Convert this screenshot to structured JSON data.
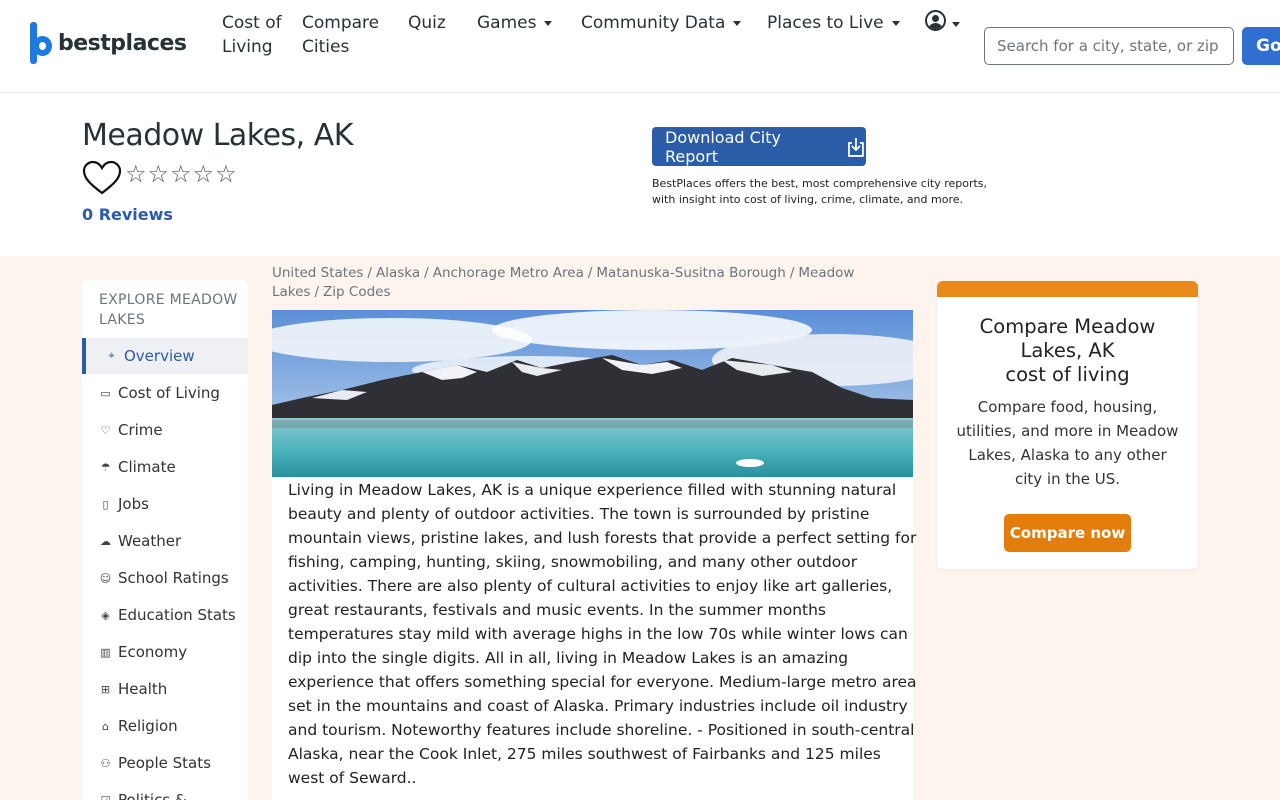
{
  "header": {
    "logo_text": "bestplaces",
    "nav": [
      {
        "label": "Cost of Living"
      },
      {
        "label": "Compare Cities"
      },
      {
        "label": "Quiz"
      },
      {
        "label": "Games"
      },
      {
        "label": "Community Data"
      },
      {
        "label": "Places to Live"
      }
    ],
    "search": {
      "placeholder": "Search for a city, state, or zip",
      "value": ""
    },
    "go_label": "Go"
  },
  "city": {
    "title": "Meadow Lakes, AK",
    "stars": "☆☆☆☆☆",
    "reviews": "0 Reviews",
    "download_label": "Download City Report",
    "download_note": "BestPlaces offers the best, most comprehensive city reports, with insight into cost of living, crime, climate, and more."
  },
  "sidebar": {
    "title": "EXPLORE MEADOW LAKES",
    "items": [
      {
        "label": "Overview",
        "icon": "map-pin-icon",
        "active": true
      },
      {
        "label": "Cost of Living",
        "icon": "wallet-icon"
      },
      {
        "label": "Crime",
        "icon": "shield-icon"
      },
      {
        "label": "Climate",
        "icon": "umbrella-icon"
      },
      {
        "label": "Jobs",
        "icon": "clipboard-icon"
      },
      {
        "label": "Weather",
        "icon": "cloud-rain-icon"
      },
      {
        "label": "School Ratings",
        "icon": "face-icon"
      },
      {
        "label": "Education Stats",
        "icon": "graduation-cap-icon"
      },
      {
        "label": "Economy",
        "icon": "bank-icon"
      },
      {
        "label": "Health",
        "icon": "medical-icon"
      },
      {
        "label": "Religion",
        "icon": "church-icon"
      },
      {
        "label": "People Stats",
        "icon": "people-icon"
      },
      {
        "label": "Politics &",
        "icon": "vote-icon"
      }
    ]
  },
  "breadcrumb": [
    "United States",
    "Alaska",
    "Anchorage Metro Area",
    "Matanuska-Susitna Borough",
    "Meadow Lakes",
    "Zip Codes"
  ],
  "main": {
    "description": "Living in Meadow Lakes, AK is a unique experience filled with stunning natural beauty and plenty of outdoor activities. The town is surrounded by pristine mountain views, pristine lakes, and lush forests that provide a perfect setting for fishing, camping, hunting, skiing, snowmobiling, and many other outdoor activities. There are also plenty of cultural activities to enjoy like art galleries, great restaurants, festivals and music events. In the summer months temperatures stay mild with average highs in the low 70s while winter lows can dip into the single digits. All in all, living in Meadow Lakes is an amazing experience that offers something special for everyone. Medium-large metro area set in the mountains and coast of Alaska. Primary industries include oil industry and tourism. Noteworthy features include shoreline. - Positioned in south-central Alaska, near the Cook Inlet, 275 miles southwest of Fairbanks and 125 miles west of Seward.."
  },
  "compare": {
    "title_line1": "Compare Meadow Lakes, AK",
    "title_line2": "cost of living",
    "description": "Compare food, housing, utilities, and more in Meadow Lakes, Alaska to any other city in the US.",
    "button": "Compare now"
  },
  "colors": {
    "brand_blue": "#2b5ca8",
    "orange": "#e37d0b",
    "band_bg": "#fdf4ee"
  }
}
